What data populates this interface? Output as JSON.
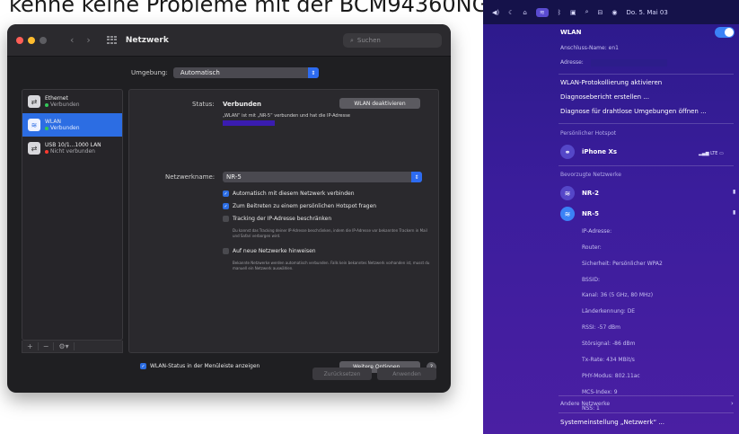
{
  "caption": "kenne keine Probleme mit der BCM94360NG!",
  "window": {
    "title": "Netzwerk",
    "search_placeholder": "Suchen",
    "traffic_lights": [
      "#ff5f57",
      "#febc2e",
      "#5d5d62"
    ],
    "nav_back": "‹",
    "nav_forward": "›"
  },
  "environment": {
    "label": "Umgebung:",
    "value": "Automatisch"
  },
  "services": [
    {
      "name": "Ethernet",
      "status": "Verbunden",
      "status_color": "#34c759"
    },
    {
      "name": "WLAN",
      "status": "Verbunden",
      "status_color": "#34c759"
    },
    {
      "name": "USB 10/1...1000 LAN",
      "status": "Nicht verbunden",
      "status_color": "#ff3b30"
    }
  ],
  "sidebar_bottom": {
    "add": "+",
    "remove": "−",
    "actions": "⚙︎▾"
  },
  "wlan": {
    "status_label": "Status:",
    "status_value": "Verbunden",
    "toggle_button": "WLAN deaktivieren",
    "status_desc": "„WLAN“ ist mit „NR-5“ verbunden und hat die IP-Adresse",
    "network_label": "Netzwerkname:",
    "network_value": "NR-5",
    "options": [
      {
        "label": "Automatisch mit diesem Netzwerk verbinden",
        "checked": true
      },
      {
        "label": "Zum Beitreten zu einem persönlichen Hotspot fragen",
        "checked": true
      },
      {
        "label": "Tracking der IP-Adresse beschränken",
        "checked": false,
        "desc": "Du kannst das Tracking deiner IP-Adresse beschränken, indem die IP-Adresse vor bekannten Trackern in Mail und Safari verborgen wird."
      },
      {
        "label": "Auf neue Netzwerke hinweisen",
        "checked": false,
        "desc": "Bekannte Netzwerke werden automatisch verbunden. Falls kein bekanntes Netzwerk vorhanden ist, musst du manuell ein Netzwerk auswählen."
      }
    ],
    "menubar_option": "WLAN-Status in der Menüleiste anzeigen",
    "more_options": "Weitere Optionen ...",
    "help": "?",
    "revert": "Zurücksetzen",
    "apply": "Anwenden"
  },
  "menubar": {
    "datetime": "Do. 5. Mai 03"
  },
  "wifi_menu": {
    "title": "WLAN",
    "interface_label": "Anschluss-Name: en1",
    "address_label": "Adresse:",
    "actions": [
      "WLAN-Protokollierung aktivieren",
      "Diagnosebericht erstellen ...",
      "Diagnose für drahtlose Umgebungen öffnen ..."
    ],
    "hotspot_header": "Persönlicher Hotspot",
    "hotspot_device": "iPhone Xs",
    "hotspot_signal": "LTE",
    "preferred_header": "Bevorzugte Netzwerke",
    "networks": [
      "NR-2",
      "NR-5"
    ],
    "details": [
      "IP-Adresse:",
      "Router:",
      "Sicherheit: Persönlicher WPA2",
      "BSSID:",
      "Kanal: 36 (5 GHz, 80 MHz)",
      "Länderkennung: DE",
      "RSSI: -57 dBm",
      "Störsignal: -86 dBm",
      "Tx-Rate: 434 MBit/s",
      "PHY-Modus: 802.11ac",
      "MCS-Index: 9",
      "NSS: 1"
    ],
    "other_networks": "Andere Netzwerke",
    "settings_link": "Systemeinstellung „Netzwerk“ ..."
  }
}
